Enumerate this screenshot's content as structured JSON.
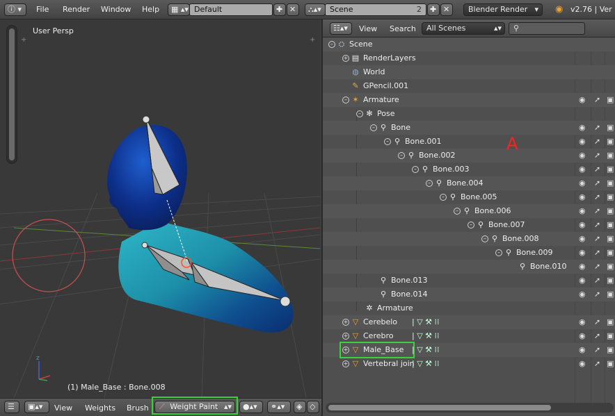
{
  "menu": {
    "info_icon": "info-icon",
    "file": "File",
    "render": "Render",
    "window": "Window",
    "help": "Help"
  },
  "layout": {
    "screen_name": "Default",
    "scene_name": "Scene",
    "scene_count": "2",
    "engine": "Blender Render",
    "version": "v2.76 | Ver"
  },
  "viewport": {
    "view_label": "User Persp",
    "status": "(1) Male_Base : Bone.008"
  },
  "viewport_header": {
    "view": "View",
    "weights": "Weights",
    "brush": "Brush",
    "mode": "Weight Paint"
  },
  "outliner": {
    "view": "View",
    "search": "Search",
    "filter": "All Scenes",
    "search_placeholder": "",
    "annotation": "A",
    "rows": [
      {
        "label": "Scene",
        "indent": 0,
        "icon": "scene-icon",
        "exp": "−"
      },
      {
        "label": "RenderLayers",
        "indent": 1,
        "icon": "renderlayers-icon",
        "exp": "+"
      },
      {
        "label": "World",
        "indent": 1,
        "icon": "world-icon",
        "exp": ""
      },
      {
        "label": "GPencil.001",
        "indent": 1,
        "icon": "grease-pencil-icon",
        "exp": ""
      },
      {
        "label": "Armature",
        "indent": 1,
        "icon": "armature-icon",
        "exp": "−",
        "vis": true
      },
      {
        "label": "Pose",
        "indent": 2,
        "icon": "pose-icon",
        "exp": "−"
      },
      {
        "label": "Bone",
        "indent": 3,
        "icon": "bone-icon",
        "exp": "−",
        "vis": true
      },
      {
        "label": "Bone.001",
        "indent": 4,
        "icon": "bone-icon",
        "exp": "−",
        "vis": true
      },
      {
        "label": "Bone.002",
        "indent": 5,
        "icon": "bone-icon",
        "exp": "−",
        "vis": true
      },
      {
        "label": "Bone.003",
        "indent": 6,
        "icon": "bone-icon",
        "exp": "−",
        "vis": true
      },
      {
        "label": "Bone.004",
        "indent": 7,
        "icon": "bone-icon",
        "exp": "−",
        "vis": true
      },
      {
        "label": "Bone.005",
        "indent": 8,
        "icon": "bone-icon",
        "exp": "−",
        "vis": true
      },
      {
        "label": "Bone.006",
        "indent": 9,
        "icon": "bone-icon",
        "exp": "−",
        "vis": true
      },
      {
        "label": "Bone.007",
        "indent": 10,
        "icon": "bone-icon",
        "exp": "−",
        "vis": true
      },
      {
        "label": "Bone.008",
        "indent": 11,
        "icon": "bone-icon",
        "exp": "−",
        "vis": true
      },
      {
        "label": "Bone.009",
        "indent": 12,
        "icon": "bone-icon",
        "exp": "−",
        "vis": true
      },
      {
        "label": "Bone.010",
        "indent": 13,
        "icon": "bone-icon",
        "exp": "",
        "vis": true
      },
      {
        "label": "Bone.013",
        "indent": 3,
        "icon": "bone-icon",
        "exp": "",
        "vis": true
      },
      {
        "label": "Bone.014",
        "indent": 3,
        "icon": "bone-icon",
        "exp": "",
        "vis": true
      },
      {
        "label": "Armature",
        "indent": 2,
        "icon": "armature-data-icon",
        "exp": ""
      },
      {
        "label": "Cerebelo",
        "indent": 1,
        "icon": "mesh-icon",
        "exp": "+",
        "vis": true,
        "extra": "mods"
      },
      {
        "label": "Cerebro",
        "indent": 1,
        "icon": "mesh-icon",
        "exp": "+",
        "vis": true,
        "extra": "mods"
      },
      {
        "label": "Male_Base",
        "indent": 1,
        "icon": "mesh-icon",
        "exp": "+",
        "vis": true,
        "extra": "mods",
        "highlight": true
      },
      {
        "label": "Vertebral join",
        "indent": 1,
        "icon": "mesh-icon",
        "exp": "+",
        "vis": true,
        "extra": "mods"
      }
    ]
  },
  "colors": {
    "highlight": "#39d439",
    "annotation": "#ff2020"
  }
}
